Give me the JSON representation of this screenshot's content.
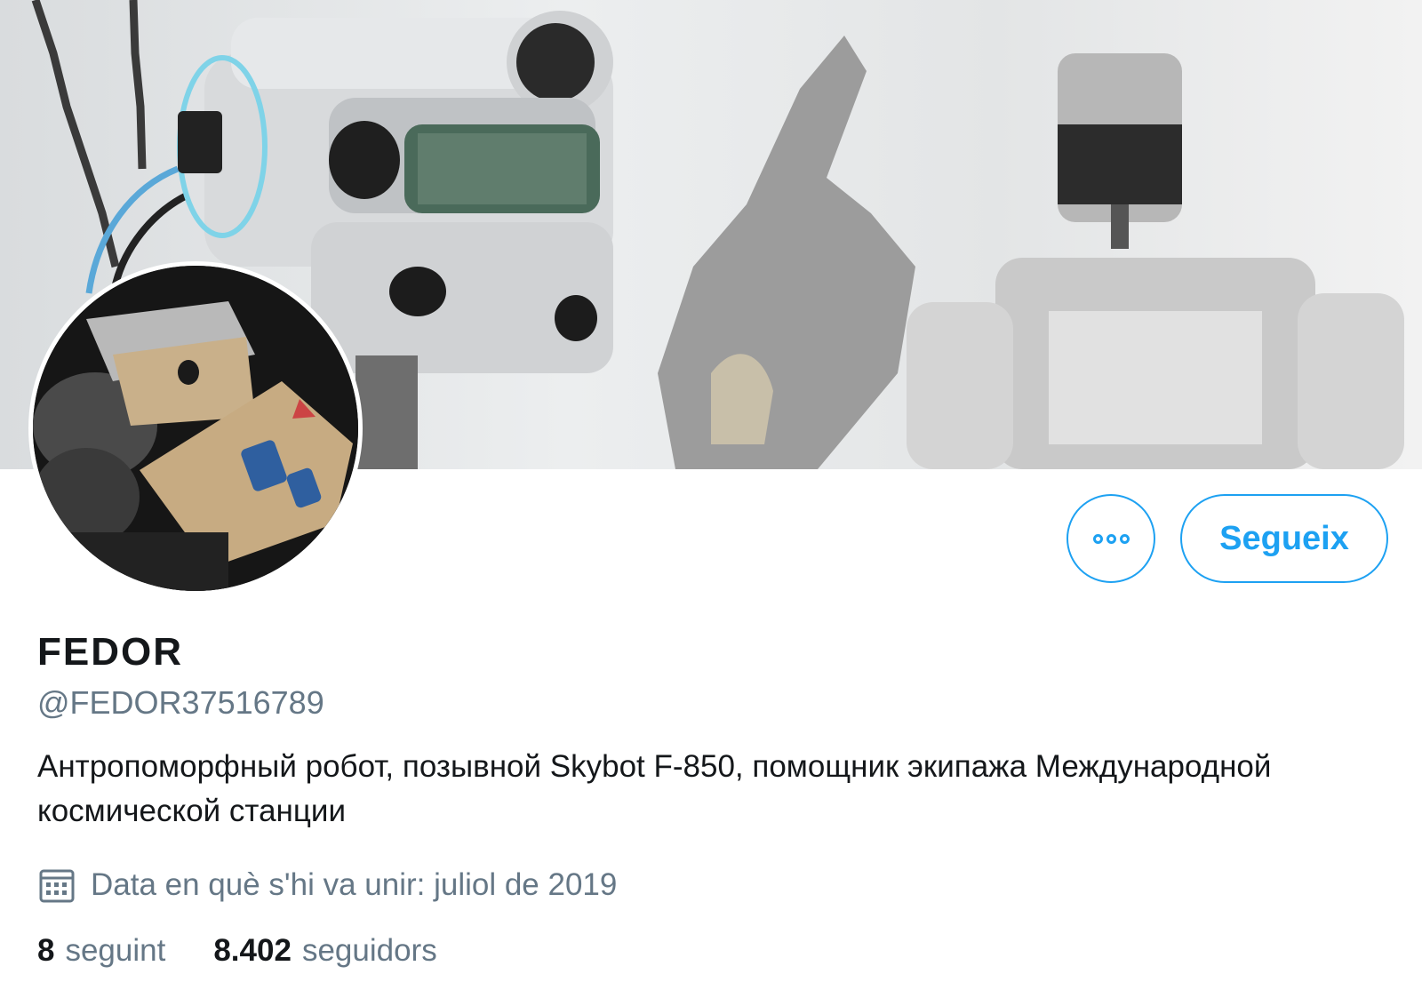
{
  "profile": {
    "name": "FEDOR",
    "handle": "@FEDOR37516789",
    "bio": "Антропоморфный робот, позывной Skybot F-850, помощник экипажа Международной космической станции",
    "joined": "Data en què s'hi va unir: juliol de 2019",
    "following_count": "8",
    "following_label": "seguint",
    "followers_count": "8.402",
    "followers_label": "seguidors"
  },
  "actions": {
    "follow_label": "Segueix",
    "more_icon": "more-dots-icon"
  },
  "colors": {
    "accent": "#1da1f2",
    "text_primary": "#14171a",
    "text_secondary": "#657786"
  }
}
